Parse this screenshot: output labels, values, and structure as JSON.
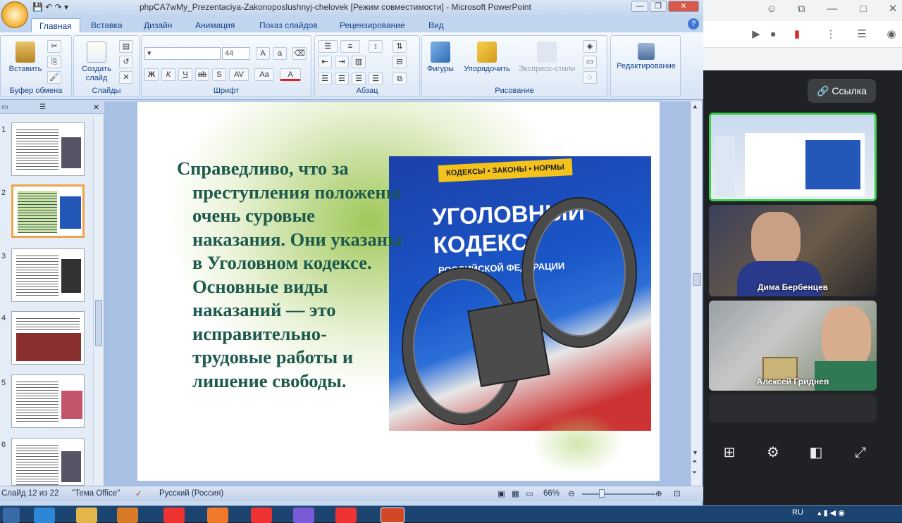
{
  "browser": {
    "link_button": "Ссылка"
  },
  "meet": {
    "participants": [
      {
        "name": "Дима Бербенцев"
      },
      {
        "name": "Алексей Гриднев"
      }
    ]
  },
  "ppt": {
    "title": "phpCA7wMy_Prezentaciya-Zakonoposlushnyj-chelovek [Режим совместимости] - Microsoft PowerPoint",
    "tabs": [
      "Главная",
      "Вставка",
      "Дизайн",
      "Анимация",
      "Показ слайдов",
      "Рецензирование",
      "Вид"
    ],
    "active_tab": "Главная",
    "ribbon": {
      "paste": "Вставить",
      "clipboard": "Буфер обмена",
      "new_slide": "Создать слайд",
      "slides": "Слайды",
      "font_size": "44",
      "font": "Шрифт",
      "paragraph": "Абзац",
      "shapes": "Фигуры",
      "arrange": "Упорядочить",
      "quick_styles": "Экспресс-стили",
      "drawing": "Рисование",
      "editing": "Редактирование"
    },
    "slide_numbers": [
      "1",
      "2",
      "3",
      "4",
      "5",
      "6"
    ],
    "slide": {
      "text": "Справедливо, что за преступления положены очень суровые наказания. Они указаны в Уголовном кодексе. Основные виды наказаний — это исправительно-трудовые работы и лишение свободы.",
      "photo_band": "КОДЕКСЫ • ЗАКОНЫ • НОРМЫ",
      "photo_title": "УГОЛОВНЫЙ КОДЕКС",
      "photo_sub": "РОССИЙСКОЙ ФЕДЕРАЦИИ"
    },
    "status": {
      "slide_pos": "Слайд 12 из 22",
      "theme": "\"Тема Office\"",
      "language": "Русский (Россия)",
      "zoom": "66%"
    }
  },
  "taskbar": {
    "lang": "RU"
  }
}
